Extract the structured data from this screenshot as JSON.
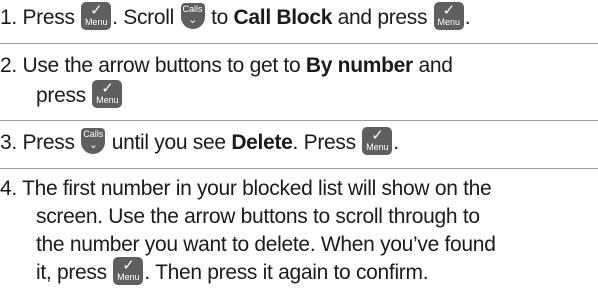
{
  "icons": {
    "menu": {
      "check": "✓",
      "label": "Menu"
    },
    "calls": {
      "label": "Calls",
      "chevron": "⌄"
    }
  },
  "steps": [
    {
      "number": "1.",
      "a": "Press",
      "b": ". Scroll",
      "c": "to",
      "bold1": "Call Block",
      "d": "and press",
      "e": "."
    },
    {
      "number": "2.",
      "line1_a": "Use the arrow buttons to get to",
      "bold1": "By number",
      "line1_b": "and",
      "line2_a": "press"
    },
    {
      "number": "3.",
      "a": "Press",
      "b": "until you see",
      "bold1": "Delete",
      "c": ". Press",
      "d": "."
    },
    {
      "number": "4.",
      "line1": "The first number in your blocked list will show on the",
      "line2": "screen. Use the arrow buttons to scroll through to",
      "line3": "the number you want to delete. When you’ve found",
      "line4_a": "it, press",
      "line4_b": ". Then press it again to confirm."
    }
  ]
}
